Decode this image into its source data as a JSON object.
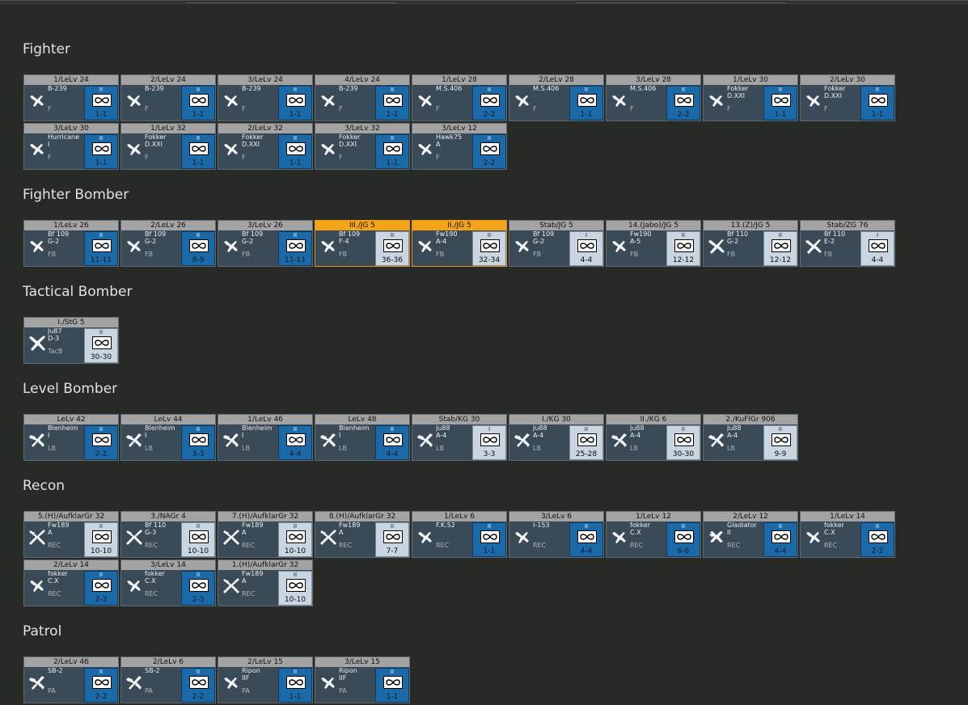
{
  "sections": [
    {
      "title": "Fighter",
      "units": [
        {
          "name": "1/LeLv 24",
          "model": "B-239",
          "variant": "",
          "role": "F",
          "size": "II",
          "strength": "1-1",
          "icon": "fighter-plane-icon"
        },
        {
          "name": "2/LeLv 24",
          "model": "B-239",
          "variant": "",
          "role": "F",
          "size": "II",
          "strength": "1-1",
          "icon": "fighter-plane-icon"
        },
        {
          "name": "3/LeLv 24",
          "model": "B-239",
          "variant": "",
          "role": "F",
          "size": "II",
          "strength": "1-1",
          "icon": "fighter-plane-icon"
        },
        {
          "name": "4/LeLv 24",
          "model": "B-239",
          "variant": "",
          "role": "F",
          "size": "II",
          "strength": "1-1",
          "icon": "fighter-plane-icon"
        },
        {
          "name": "1/LeLv 28",
          "model": "M.S.406",
          "variant": "",
          "role": "F",
          "size": "II",
          "strength": "2-2",
          "icon": "fighter-plane-icon"
        },
        {
          "name": "2/LeLv 28",
          "model": "M.S.406",
          "variant": "",
          "role": "F",
          "size": "II",
          "strength": "1-1",
          "icon": "fighter-plane-icon"
        },
        {
          "name": "3/LeLv 28",
          "model": "M.S.406",
          "variant": "",
          "role": "F",
          "size": "II",
          "strength": "2-2",
          "icon": "fighter-plane-icon"
        },
        {
          "name": "1/LeLv 30",
          "model": "Fokker",
          "variant": "D.XXI",
          "role": "F",
          "size": "II",
          "strength": "1-1",
          "icon": "fighter-plane-icon"
        },
        {
          "name": "2/LeLv 30",
          "model": "Fokker",
          "variant": "D.XXI",
          "role": "F",
          "size": "II",
          "strength": "1-1",
          "icon": "fighter-plane-icon"
        },
        {
          "name": "3/LeLv 30",
          "model": "Hurricane",
          "variant": "I",
          "role": "F",
          "size": "II",
          "strength": "1-1",
          "icon": "fighter-plane-icon"
        },
        {
          "name": "1/LeLv 32",
          "model": "Fokker",
          "variant": "D.XXI",
          "role": "F",
          "size": "II",
          "strength": "1-1",
          "icon": "fighter-plane-icon"
        },
        {
          "name": "2/LeLv 32",
          "model": "Fokker",
          "variant": "D.XXI",
          "role": "F",
          "size": "II",
          "strength": "1-1",
          "icon": "fighter-plane-icon"
        },
        {
          "name": "3/LeLv 32",
          "model": "Fokker",
          "variant": "D.XXI",
          "role": "F",
          "size": "II",
          "strength": "1-1",
          "icon": "fighter-plane-icon"
        },
        {
          "name": "3/LeLv 12",
          "model": "Hawk75",
          "variant": "A",
          "role": "F",
          "size": "II",
          "strength": "2-2",
          "icon": "fighter-plane-icon"
        }
      ]
    },
    {
      "title": "Fighter Bomber",
      "units": [
        {
          "name": "1/LeLv 26",
          "model": "Bf 109",
          "variant": "G-2",
          "role": "FB",
          "size": "II",
          "strength": "11-11",
          "icon": "fighter-plane-icon"
        },
        {
          "name": "2/LeLv 26",
          "model": "Bf 109",
          "variant": "G-2",
          "role": "FB",
          "size": "II",
          "strength": "8-9",
          "icon": "fighter-plane-icon"
        },
        {
          "name": "3/LeLv 26",
          "model": "Bf 109",
          "variant": "G-2",
          "role": "FB",
          "size": "II",
          "strength": "11-11",
          "icon": "fighter-plane-icon"
        },
        {
          "name": "III./JG 5",
          "model": "Bf 109",
          "variant": "F-4",
          "role": "FB",
          "size": "II",
          "strength": "36-36",
          "icon": "fighter-plane-icon",
          "highlight": true,
          "light": true
        },
        {
          "name": "II./JG 5",
          "model": "Fw190",
          "variant": "A-4",
          "role": "FB",
          "size": "II",
          "strength": "32-34",
          "icon": "fighter-plane-icon",
          "highlight": true,
          "light": true
        },
        {
          "name": "Stab/JG 5",
          "model": "Bf 109",
          "variant": "G-2",
          "role": "FB",
          "size": "I",
          "strength": "4-4",
          "icon": "fighter-plane-icon",
          "light": true
        },
        {
          "name": "14.(Jabo)/JG 5",
          "model": "Fw190",
          "variant": "A-5",
          "role": "FB",
          "size": "II",
          "strength": "12-12",
          "icon": "fighter-plane-icon",
          "light": true
        },
        {
          "name": "13.(Z)/JG 5",
          "model": "Bf 110",
          "variant": "G-2",
          "role": "FB",
          "size": "II",
          "strength": "12-12",
          "icon": "twin-engine-plane-icon",
          "light": true
        },
        {
          "name": "Stab/ZG 76",
          "model": "Bf 110",
          "variant": "E-2",
          "role": "FB",
          "size": "I",
          "strength": "4-4",
          "icon": "twin-engine-plane-icon",
          "light": true
        }
      ]
    },
    {
      "title": "Tactical Bomber",
      "units": [
        {
          "name": "I./StG 5",
          "model": "Ju87",
          "variant": "D-3",
          "role": "TacB",
          "size": "II",
          "strength": "30-30",
          "icon": "dive-bomber-icon",
          "light": true
        }
      ]
    },
    {
      "title": "Level Bomber",
      "units": [
        {
          "name": "LeLv 42",
          "model": "Blenheim",
          "variant": "I",
          "role": "LB",
          "size": "II",
          "strength": "2-2",
          "icon": "bomber-plane-icon"
        },
        {
          "name": "LeLv 44",
          "model": "Blenheim",
          "variant": "I",
          "role": "LB",
          "size": "II",
          "strength": "3-3",
          "icon": "bomber-plane-icon"
        },
        {
          "name": "1/LeLv 46",
          "model": "Blenheim",
          "variant": "I",
          "role": "LB",
          "size": "II",
          "strength": "4-4",
          "icon": "bomber-plane-icon"
        },
        {
          "name": "LeLv 48",
          "model": "Blenheim",
          "variant": "I",
          "role": "LB",
          "size": "II",
          "strength": "4-4",
          "icon": "bomber-plane-icon"
        },
        {
          "name": "Stab/KG 30",
          "model": "Ju88",
          "variant": "A-4",
          "role": "LB",
          "size": "I",
          "strength": "3-3",
          "icon": "bomber-plane-icon",
          "light": true
        },
        {
          "name": "I./KG 30",
          "model": "Ju88",
          "variant": "A-4",
          "role": "LB",
          "size": "II",
          "strength": "25-28",
          "icon": "bomber-plane-icon",
          "light": true
        },
        {
          "name": "II./KG 6",
          "model": "Ju88",
          "variant": "A-4",
          "role": "LB",
          "size": "II",
          "strength": "30-30",
          "icon": "bomber-plane-icon",
          "light": true
        },
        {
          "name": "2./KuFlGr 906",
          "model": "Ju88",
          "variant": "A-4",
          "role": "LB",
          "size": "II",
          "strength": "9-9",
          "icon": "bomber-plane-icon",
          "light": true
        }
      ]
    },
    {
      "title": "Recon",
      "units": [
        {
          "name": "5.(H)/AufklarGr 32",
          "model": "Fw189",
          "variant": "A",
          "role": "REC",
          "size": "II",
          "strength": "10-10",
          "icon": "recon-plane-icon",
          "light": true
        },
        {
          "name": "3./NAGr 4",
          "model": "Bf 110",
          "variant": "G-3",
          "role": "REC",
          "size": "II",
          "strength": "10-10",
          "icon": "recon-plane-icon",
          "light": true
        },
        {
          "name": "7.(H)/AufklarGr 32",
          "model": "Fw189",
          "variant": "A",
          "role": "REC",
          "size": "II",
          "strength": "10-10",
          "icon": "recon-plane-icon",
          "light": true
        },
        {
          "name": "8.(H)/AufklarGr 32",
          "model": "Fw189",
          "variant": "A",
          "role": "REC",
          "size": "II",
          "strength": "7-7",
          "icon": "recon-plane-icon",
          "light": true
        },
        {
          "name": "1/LeLv 6",
          "model": "F.K.52",
          "variant": "",
          "role": "REC",
          "size": "II",
          "strength": "1-1",
          "icon": "fighter-plane-icon"
        },
        {
          "name": "3/LeLv 6",
          "model": "I-153",
          "variant": "",
          "role": "REC",
          "size": "II",
          "strength": "4-4",
          "icon": "fighter-plane-icon"
        },
        {
          "name": "1/LeLv 12",
          "model": "fokker",
          "variant": "C.X",
          "role": "REC",
          "size": "II",
          "strength": "6-6",
          "icon": "fighter-plane-icon"
        },
        {
          "name": "2/LeLv 12",
          "model": "Gladiator",
          "variant": "II",
          "role": "REC",
          "size": "II",
          "strength": "4-4",
          "icon": "biplane-icon"
        },
        {
          "name": "1/LeLv 14",
          "model": "fokker",
          "variant": "C.X",
          "role": "REC",
          "size": "II",
          "strength": "2-2",
          "icon": "fighter-plane-icon"
        },
        {
          "name": "2/LeLv 14",
          "model": "fokker",
          "variant": "C.X",
          "role": "REC",
          "size": "II",
          "strength": "2-3",
          "icon": "fighter-plane-icon"
        },
        {
          "name": "3/LeLv 14",
          "model": "fokker",
          "variant": "C.X",
          "role": "REC",
          "size": "II",
          "strength": "2-3",
          "icon": "fighter-plane-icon"
        },
        {
          "name": "1.(H)/AufklarGr 32",
          "model": "Fw189",
          "variant": "A",
          "role": "REC",
          "size": "II",
          "strength": "10-10",
          "icon": "recon-plane-icon",
          "light": true
        }
      ]
    },
    {
      "title": "Patrol",
      "units": [
        {
          "name": "2/LeLv 46",
          "model": "SB-2",
          "variant": "",
          "role": "PA",
          "size": "II",
          "strength": "2-2",
          "icon": "bomber-plane-icon"
        },
        {
          "name": "2/LeLv 6",
          "model": "SB-2",
          "variant": "",
          "role": "PA",
          "size": "II",
          "strength": "2-2",
          "icon": "bomber-plane-icon"
        },
        {
          "name": "2/LeLv 15",
          "model": "Ripon",
          "variant": "IIF",
          "role": "PA",
          "size": "II",
          "strength": "1-1",
          "icon": "fighter-plane-icon"
        },
        {
          "name": "3/LeLv 15",
          "model": "Ripon",
          "variant": "IIF",
          "role": "PA",
          "size": "II",
          "strength": "1-1",
          "icon": "fighter-plane-icon"
        }
      ]
    }
  ],
  "colors": {
    "background": "#272a26",
    "card": "#3a4a57",
    "header": "#a3a3a3",
    "highlight": "#f2a318",
    "counter_finnish": "#1c69a8",
    "counter_german": "#c9d6e2"
  }
}
